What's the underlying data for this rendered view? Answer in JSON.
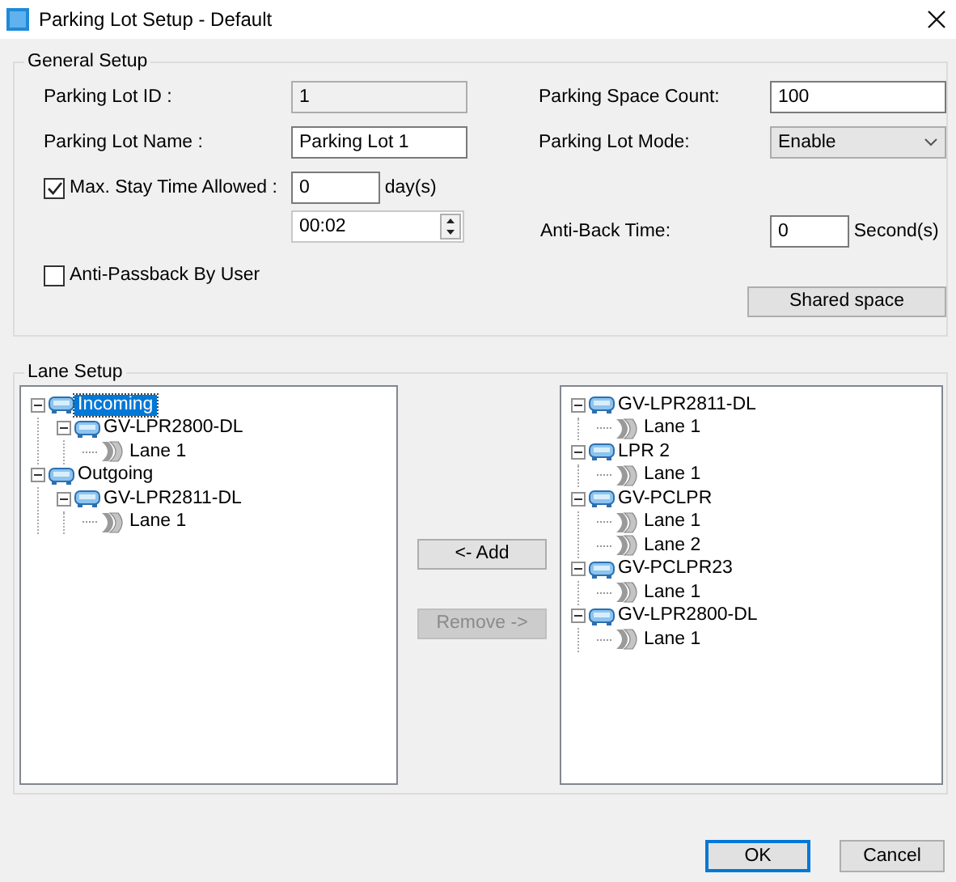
{
  "window": {
    "title": "Parking Lot Setup - Default"
  },
  "general_setup": {
    "title": "General Setup",
    "parking_lot_id": {
      "label": "Parking Lot ID :",
      "value": "1",
      "disabled": true
    },
    "parking_lot_name": {
      "label": "Parking Lot Name :",
      "value": "Parking Lot 1",
      "disabled": false
    },
    "max_stay": {
      "label": "Max. Stay Time Allowed :",
      "checked": true,
      "days_value": "0",
      "days_unit": "day(s)",
      "time_value": "00:02"
    },
    "anti_passback": {
      "label": "Anti-Passback By User",
      "checked": false
    },
    "parking_space_count": {
      "label": "Parking Space Count:",
      "value": "100"
    },
    "parking_lot_mode": {
      "label": "Parking Lot Mode:",
      "value": "Enable"
    },
    "anti_back_time": {
      "label": "Anti-Back Time:",
      "value": "0",
      "unit": "Second(s)"
    },
    "shared_space_button": {
      "label": "Shared space"
    }
  },
  "lane_setup": {
    "title": "Lane Setup",
    "assigned_tree": [
      {
        "label": "Incoming",
        "kind": "device",
        "expanded": true,
        "selected": true,
        "children": [
          {
            "label": "GV-LPR2800-DL",
            "kind": "device",
            "expanded": true,
            "selected": false,
            "children": [
              {
                "label": "Lane 1",
                "kind": "lane",
                "selected": false
              }
            ]
          }
        ]
      },
      {
        "label": "Outgoing",
        "kind": "device",
        "expanded": true,
        "selected": false,
        "children": [
          {
            "label": "GV-LPR2811-DL",
            "kind": "device",
            "expanded": true,
            "selected": false,
            "children": [
              {
                "label": "Lane 1",
                "kind": "lane",
                "selected": false
              }
            ]
          }
        ]
      }
    ],
    "add_button": {
      "label": "<- Add",
      "disabled": false
    },
    "remove_button": {
      "label": "Remove ->",
      "disabled": true
    },
    "available_tree": [
      {
        "label": "GV-LPR2811-DL",
        "kind": "device",
        "expanded": true,
        "selected": false,
        "children": [
          {
            "label": "Lane 1",
            "kind": "lane",
            "selected": false
          }
        ]
      },
      {
        "label": "LPR 2",
        "kind": "device",
        "expanded": true,
        "selected": false,
        "children": [
          {
            "label": "Lane 1",
            "kind": "lane",
            "selected": false
          }
        ]
      },
      {
        "label": "GV-PCLPR",
        "kind": "device",
        "expanded": true,
        "selected": false,
        "children": [
          {
            "label": "Lane 1",
            "kind": "lane",
            "selected": false
          },
          {
            "label": "Lane 2",
            "kind": "lane",
            "selected": false
          }
        ]
      },
      {
        "label": "GV-PCLPR23",
        "kind": "device",
        "expanded": true,
        "selected": false,
        "children": [
          {
            "label": "Lane 1",
            "kind": "lane",
            "selected": false
          }
        ]
      },
      {
        "label": "GV-LPR2800-DL",
        "kind": "device",
        "expanded": true,
        "selected": false,
        "children": [
          {
            "label": "Lane 1",
            "kind": "lane",
            "selected": false
          }
        ]
      }
    ]
  },
  "buttons": [
    {
      "label": "OK",
      "default": true
    },
    {
      "label": "Cancel",
      "default": false
    }
  ]
}
